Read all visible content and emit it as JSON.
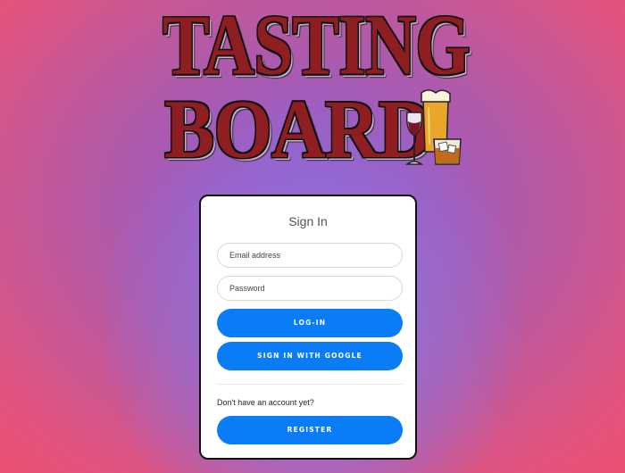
{
  "logo": {
    "line1": "TASTING",
    "line2": "BOARD",
    "drinks_icon": "drinks-glasses-icon"
  },
  "signin": {
    "title": "Sign In",
    "email_placeholder": "Email address",
    "password_placeholder": "Password",
    "login_label": "LOG-IN",
    "google_label": "SIGN IN WITH GOOGLE",
    "no_account_text": "Don't have an account yet?",
    "register_label": "REGISTER"
  },
  "colors": {
    "accent": "#0a7df6",
    "logo_red": "#8f1e23",
    "bg_pink": "#ec4f6e",
    "bg_purple": "#8a5bd8"
  }
}
